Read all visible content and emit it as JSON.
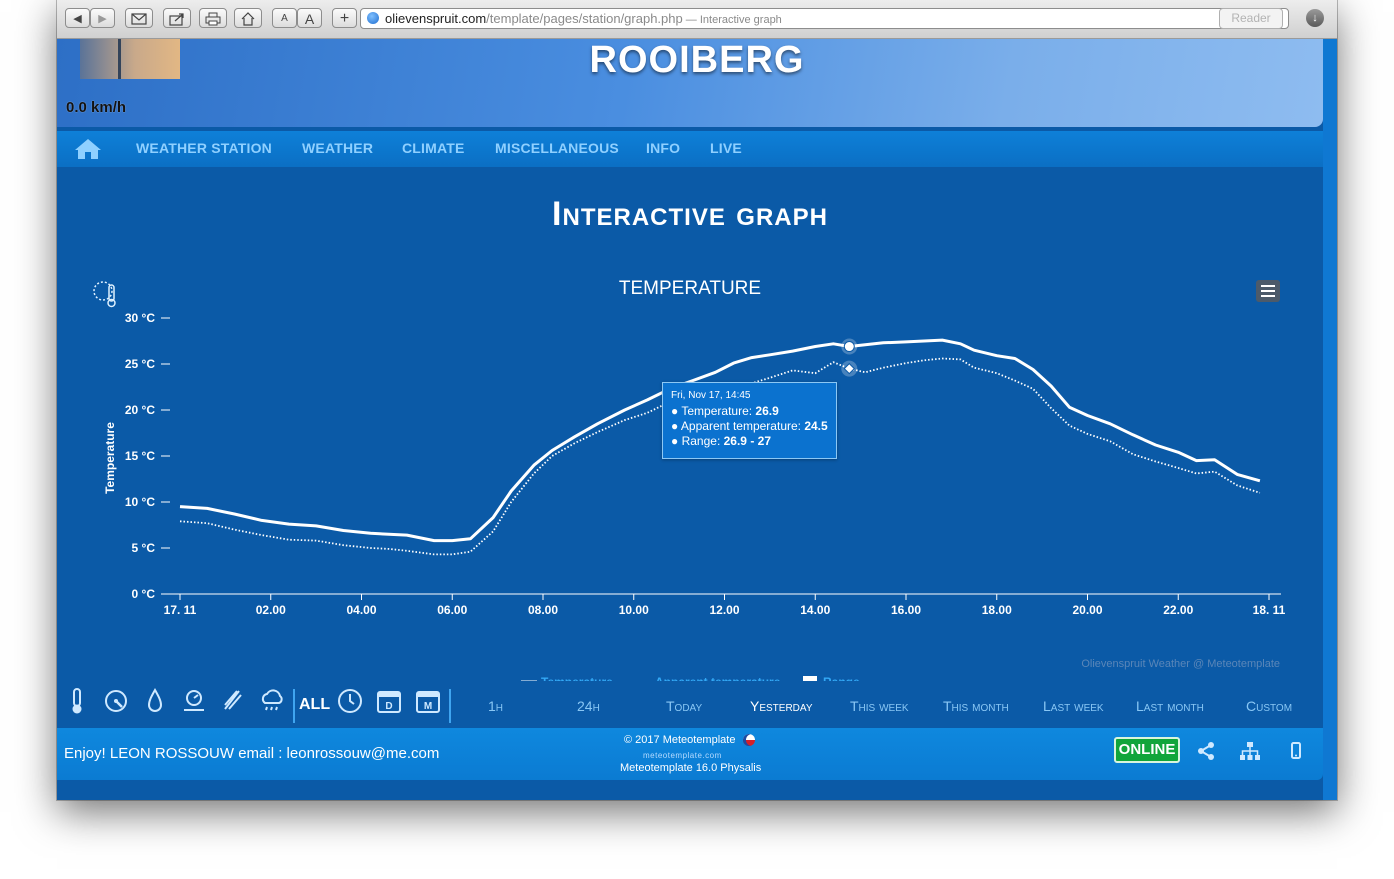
{
  "browser": {
    "url_domain": "olievenspruit.com",
    "url_path": "/template/pages/station/graph.php",
    "page_title_suffix": " — Interactive graph",
    "reader_label": "Reader",
    "font_small": "A",
    "font_large": "A",
    "add_label": "+"
  },
  "header": {
    "site_title": "ROOIBERG",
    "wind_speed": "0.0 km/h"
  },
  "nav": {
    "items": [
      "WEATHER STATION",
      "WEATHER",
      "CLIMATE",
      "MISCELLANEOUS",
      "INFO",
      "LIVE"
    ]
  },
  "page": {
    "title": "Interactive graph"
  },
  "chart_data": {
    "type": "line",
    "title": "TEMPERATURE",
    "ylabel": "Temperature",
    "ylim": [
      0,
      30
    ],
    "y_ticks": [
      "0 °C",
      "5 °C",
      "10 °C",
      "15 °C",
      "20 °C",
      "25 °C",
      "30 °C"
    ],
    "x_tick_labels": [
      "17. 11",
      "02.00",
      "04.00",
      "06.00",
      "08.00",
      "10.00",
      "12.00",
      "14.00",
      "16.00",
      "18.00",
      "20.00",
      "22.00",
      "18. 11"
    ],
    "x_hours": [
      0,
      2,
      4,
      6,
      8,
      10,
      12,
      14,
      16,
      18,
      20,
      22,
      24
    ],
    "series": [
      {
        "name": "Temperature",
        "style": "solid",
        "x": [
          0,
          0.6,
          1.2,
          1.8,
          2.4,
          3,
          3.6,
          4.2,
          4.6,
          5,
          5.6,
          6,
          6.4,
          6.9,
          7.3,
          7.8,
          8.2,
          8.7,
          9.2,
          9.8,
          10.3,
          10.8,
          11.3,
          11.8,
          12.2,
          12.6,
          13,
          13.5,
          14,
          14.4,
          14.75,
          15.1,
          15.5,
          16,
          16.4,
          16.8,
          17.2,
          17.5,
          18,
          18.4,
          18.8,
          19.2,
          19.6,
          20,
          20.5,
          21,
          21.5,
          22,
          22.4,
          22.8,
          23.3,
          23.8
        ],
        "values": [
          9.5,
          9.3,
          8.7,
          8.0,
          7.6,
          7.4,
          6.9,
          6.6,
          6.5,
          6.4,
          5.8,
          5.8,
          6.0,
          8.3,
          11.2,
          14.0,
          15.6,
          17.1,
          18.5,
          20.0,
          21.1,
          22.3,
          23.2,
          24.1,
          25.1,
          25.7,
          26.0,
          26.4,
          26.9,
          27.2,
          26.9,
          27.1,
          27.3,
          27.4,
          27.5,
          27.6,
          27.2,
          26.5,
          25.9,
          25.6,
          24.4,
          22.6,
          20.3,
          19.4,
          18.5,
          17.3,
          16.2,
          15.4,
          14.5,
          14.6,
          13.0,
          12.3
        ]
      },
      {
        "name": "Apparent temperature",
        "style": "dotted",
        "x": [
          0,
          0.6,
          1.2,
          1.8,
          2.4,
          3,
          3.6,
          4.2,
          4.6,
          5,
          5.6,
          6,
          6.4,
          6.9,
          7.3,
          7.8,
          8.2,
          8.7,
          9.2,
          9.8,
          10.3,
          10.8,
          11.3,
          11.8,
          12.2,
          12.6,
          13,
          13.5,
          14,
          14.4,
          14.75,
          15.1,
          15.5,
          16,
          16.4,
          16.8,
          17.2,
          17.5,
          18,
          18.4,
          18.8,
          19.2,
          19.6,
          20,
          20.5,
          21,
          21.5,
          22,
          22.4,
          22.8,
          23.3,
          23.8
        ],
        "values": [
          7.9,
          7.7,
          7.0,
          6.4,
          5.9,
          5.8,
          5.3,
          5.0,
          4.9,
          4.7,
          4.3,
          4.3,
          4.6,
          6.8,
          10.0,
          13.1,
          15.0,
          16.4,
          17.6,
          18.9,
          19.7,
          20.9,
          21.8,
          22.6,
          22.8,
          22.9,
          23.5,
          24.3,
          24.0,
          25.2,
          24.5,
          24.1,
          24.6,
          25.1,
          25.4,
          25.6,
          25.5,
          24.6,
          24.0,
          23.2,
          22.3,
          20.2,
          18.3,
          17.4,
          16.6,
          15.2,
          14.4,
          13.7,
          13.1,
          13.3,
          11.8,
          11.0
        ]
      },
      {
        "name": "Range",
        "style": "area"
      }
    ],
    "legend_position": "bottom",
    "credit": "Olievenspruit Weather @ Meteotemplate",
    "tooltip": {
      "date": "Fri, Nov 17, 14:45",
      "rows": [
        {
          "label": "Temperature: ",
          "value": "26.9"
        },
        {
          "label": "Apparent temperature: ",
          "value": "24.5"
        },
        {
          "label": "Range: ",
          "value": "26.9 - 27"
        }
      ]
    }
  },
  "controls": {
    "all_label": "ALL",
    "ranges": [
      "1h",
      "24h",
      "Today",
      "Yesterday",
      "This week",
      "This month",
      "Last week",
      "Last month",
      "Custom"
    ],
    "active_range": "Yesterday",
    "icons": [
      "thermometer-icon",
      "gauge-icon",
      "drop-icon",
      "barometer-icon",
      "wind-icon",
      "rain-icon",
      "clock-icon",
      "day-calendar-icon",
      "month-calendar-icon"
    ],
    "day_letter": "D",
    "month_letter": "M"
  },
  "footer": {
    "enjoy_text": "Enjoy! LEON ROSSOUW email : leonrossouw@me.com",
    "copyright": "© 2017  Meteotemplate",
    "site": "meteotemplate.com",
    "version": "Meteotemplate 16.0 Physalis",
    "status": "ONLINE"
  },
  "colors": {
    "page_bg": "#0b5aa7",
    "accent": "#0f88de",
    "nav_text": "#8fd0ff",
    "online": "#11a53b"
  }
}
